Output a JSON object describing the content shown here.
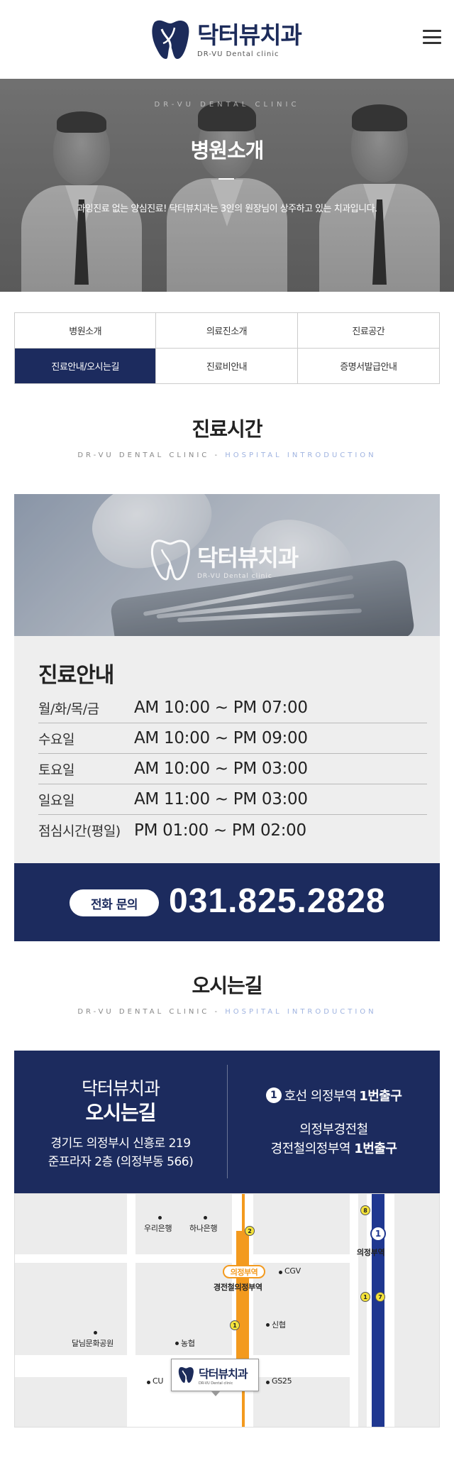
{
  "brand": {
    "name_ko": "닥터뷰치과",
    "name_en": "DR-VU Dental clinic",
    "mark_text": ".VU",
    "color_primary": "#1c2b5e"
  },
  "header": {
    "menu_icon": "hamburger-menu-icon"
  },
  "hero": {
    "subtitle": "DR-VU DENTAL CLINIC",
    "title": "병원소개",
    "description": "과잉진료 없는 양심진료! 닥터뷰치과는 3인의 원장님이 상주하고 있는 치과입니다."
  },
  "tabs": [
    {
      "label": "병원소개",
      "active": false
    },
    {
      "label": "의료진소개",
      "active": false
    },
    {
      "label": "진료공간",
      "active": false
    },
    {
      "label": "진료안내/오시는길",
      "active": true
    },
    {
      "label": "진료비안내",
      "active": false
    },
    {
      "label": "증명서발급안내",
      "active": false
    }
  ],
  "hours_section": {
    "title": "진료시간",
    "sub_a": "DR-VU DENTAL CLINIC -",
    "sub_b": "HOSPITAL INTRODUCTION"
  },
  "hours": {
    "title": "진료안내",
    "rows": [
      {
        "day": "월/화/목/금",
        "time": "AM 10:00 ~ PM 07:00"
      },
      {
        "day": "수요일",
        "time": "AM 10:00 ~ PM 09:00"
      },
      {
        "day": "토요일",
        "time": "AM 10:00 ~ PM 03:00"
      },
      {
        "day": "일요일",
        "time": "AM 11:00 ~ PM 03:00"
      },
      {
        "day": "점심시간(평일)",
        "time": "PM 01:00 ~ PM 02:00"
      }
    ]
  },
  "phone": {
    "label": "전화 문의",
    "number": "031.825.2828"
  },
  "directions_section": {
    "title": "오시는길",
    "sub_a": "DR-VU DENTAL CLINIC -",
    "sub_b": "HOSPITAL INTRODUCTION"
  },
  "directions": {
    "clinic_name": "닥터뷰치과",
    "title": "오시는길",
    "address_1": "경기도 의정부시 신흥로 219",
    "address_2": "준프라자 2층 (의정부동 566)",
    "line_num": "1",
    "line_text": "호선 의정부역",
    "line_exit": "1번출구",
    "rail_1": "의정부경전철",
    "rail_2_text": "경전철의정부역",
    "rail_2_exit": "1번출구"
  },
  "map": {
    "pois": {
      "woori": "우리은행",
      "hana": "하나은행",
      "cgv": "CGV",
      "shinhyup": "신협",
      "dalnim": "달님문화공원",
      "nonghyup": "농협",
      "cu": "CU",
      "gs25": "GS25"
    },
    "station_tag": "의정부역",
    "station_light": "경전철의정부역",
    "station_main": "의정부역",
    "line_circle": "1",
    "exits": {
      "e2": "2",
      "e1a": "1",
      "e8": "8",
      "e1b": "1",
      "e7": "7"
    },
    "rail_colors": {
      "light_rail": "#f39a1e",
      "line1": "#1f3790"
    }
  }
}
